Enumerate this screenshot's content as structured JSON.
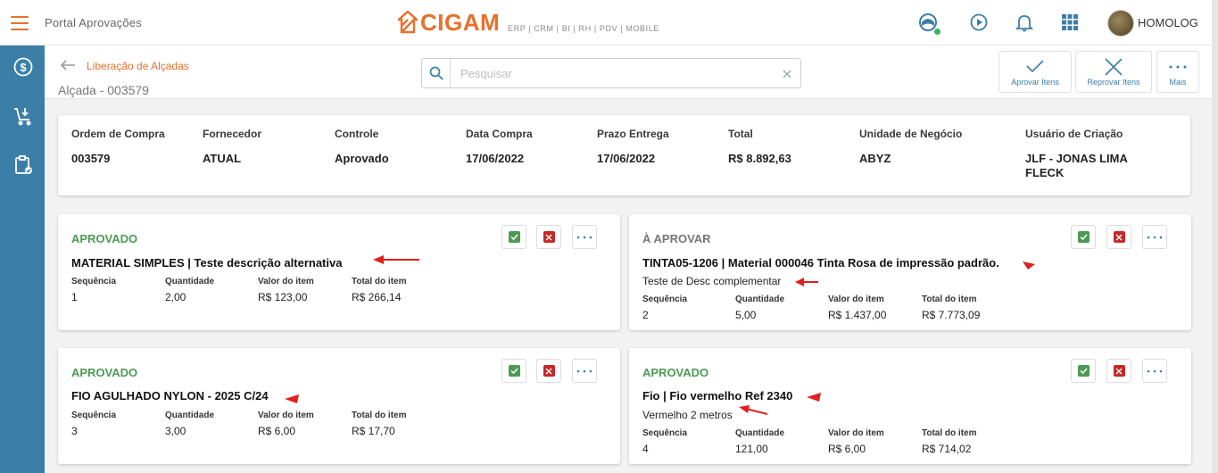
{
  "header": {
    "portal_title": "Portal Aprovações",
    "logo_text": "CIGAM",
    "logo_subtitle": "ERP | CRM | BI | RH | PDV | MOBILE",
    "username": "HOMOLOG"
  },
  "subheader": {
    "breadcrumb": "Liberação de Alçadas",
    "title": "Alçada - 003579",
    "search_placeholder": "Pesquisar",
    "search_value": "",
    "approve_label": "Aprovar Itens",
    "reject_label": "Reprovar Itens",
    "more_label": "Mais"
  },
  "summary": [
    {
      "label": "Ordem de Compra",
      "value": "003579"
    },
    {
      "label": "Fornecedor",
      "value": "ATUAL"
    },
    {
      "label": "Controle",
      "value": "Aprovado"
    },
    {
      "label": "Data Compra",
      "value": "17/06/2022"
    },
    {
      "label": "Prazo Entrega",
      "value": "17/06/2022"
    },
    {
      "label": "Total",
      "value": "R$ 8.892,63"
    },
    {
      "label": "Unidade de Negócio",
      "value": "ABYZ"
    },
    {
      "label": "Usuário de Criação",
      "value": "JLF - JONAS LIMA FLECK"
    }
  ],
  "field_labels": {
    "sequencia": "Sequência",
    "quantidade": "Quantidade",
    "valor": "Valor do item",
    "total": "Total do item"
  },
  "items": [
    {
      "status": "APROVADO",
      "title": "MATERIAL SIMPLES | Teste descrição alternativa",
      "description": "",
      "sequencia": "1",
      "quantidade": "2,00",
      "valor": "R$ 123,00",
      "total": "R$ 266,14"
    },
    {
      "status": "À APROVAR",
      "title": "TINTA05-1206 | Material 000046 Tinta Rosa de impressão padrão.",
      "description": "Teste de Desc complementar",
      "sequencia": "2",
      "quantidade": "5,00",
      "valor": "R$ 1.437,00",
      "total": "R$ 7.773,09"
    },
    {
      "status": "APROVADO",
      "title": "FIO AGULHADO NYLON - 2025 C/24",
      "description": "",
      "sequencia": "3",
      "quantidade": "3,00",
      "valor": "R$ 6,00",
      "total": "R$ 17,70"
    },
    {
      "status": "APROVADO",
      "title": "Fio | Fio vermelho Ref 2340",
      "description": "Vermelho 2 metros",
      "sequencia": "4",
      "quantidade": "121,00",
      "valor": "R$ 6,00",
      "total": "R$ 714,02"
    }
  ],
  "colors": {
    "brand_orange": "#e8702a",
    "sidebar_blue": "#3b7fa8",
    "approved_green": "#4c9a52",
    "reject_red": "#c62828"
  },
  "icons": [
    "menu-icon",
    "support-icon",
    "play-icon",
    "bell-icon",
    "apps-grid-icon",
    "money-icon",
    "cart-download-icon",
    "clipboard-check-icon",
    "search-icon",
    "clear-icon",
    "check-icon",
    "close-icon",
    "more-icon"
  ]
}
